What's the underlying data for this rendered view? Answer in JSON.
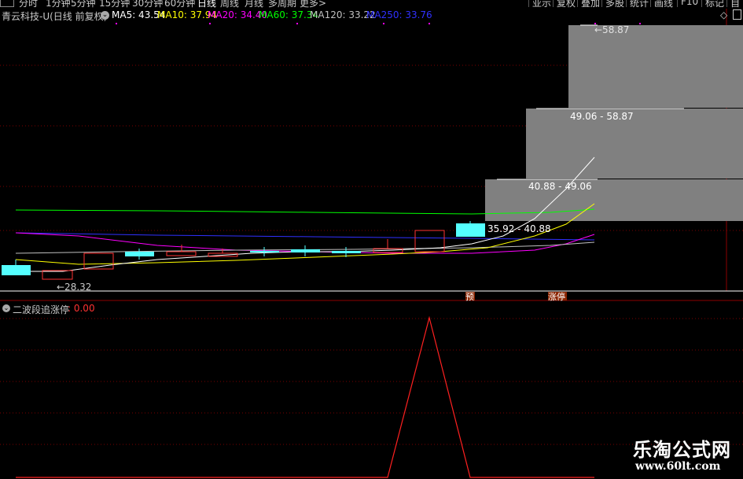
{
  "toolbar": {
    "periods": [
      "分时",
      "1分钟",
      "5分钟",
      "15分钟",
      "30分钟",
      "60分钟",
      "日线",
      "周线",
      "月线",
      "多周期",
      "更多>"
    ],
    "active_period": "日线",
    "buttons": [
      "复权",
      "叠加",
      "多股",
      "统计",
      "画线",
      "F10",
      "标记",
      "自"
    ],
    "first_button_partial": "亚示"
  },
  "main_chart": {
    "title": "青云科技-U(日线 前复权)",
    "ma_legend": [
      {
        "label": "MA5: 43.54",
        "color": "#ffffff"
      },
      {
        "label": "MA10: 37.94",
        "color": "#ffff00"
      },
      {
        "label": "MA20: 34.40",
        "color": "#ff00ff"
      },
      {
        "label": "MA60: 37.34",
        "color": "#00ff00"
      },
      {
        "label": "MA120: 33.22",
        "color": "#c0c0c0"
      },
      {
        "label": "MA250: 33.76",
        "color": "#3030ff"
      }
    ],
    "price_low_label": "←28.32",
    "price_high_label": "←58.87",
    "bands": [
      {
        "label": "49.06 - 58.87"
      },
      {
        "label": "40.88 - 49.06"
      },
      {
        "label": "35.92 - 40.88"
      }
    ],
    "tags": [
      "预",
      "涨停"
    ]
  },
  "indicator": {
    "name": "二波段追涨停",
    "value": ": 0.00"
  },
  "colors": {
    "up": "#ff3232",
    "down": "#54ffff",
    "grid": "#8b0000",
    "band": "#808080"
  },
  "watermark": {
    "line1": "乐淘公式网",
    "line2": "www.60lt.com"
  }
}
